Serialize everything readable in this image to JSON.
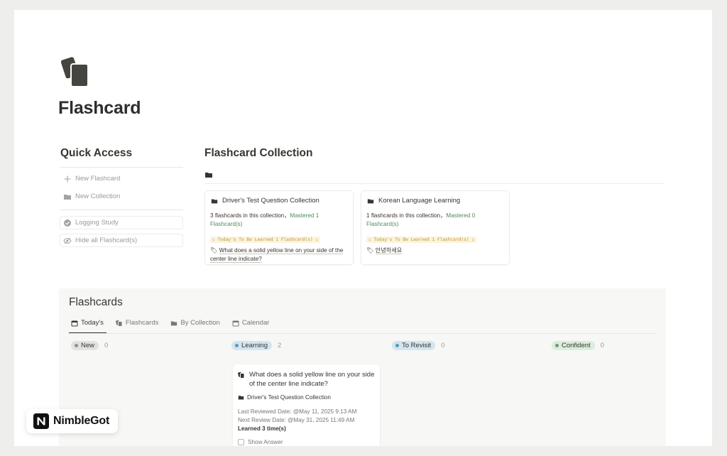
{
  "page": {
    "title": "Flashcard"
  },
  "quick_access": {
    "heading": "Quick Access",
    "items": [
      {
        "label": "New Flashcard",
        "icon": "plus-icon"
      },
      {
        "label": "New Collection",
        "icon": "folder-icon"
      },
      {
        "label": "Logging Study",
        "icon": "check-circle-icon"
      },
      {
        "label": "Hide all Flashcard(s)",
        "icon": "eye-off-icon"
      }
    ]
  },
  "collection": {
    "heading": "Flashcard Collection",
    "cards": [
      {
        "title": "Driver's Test Question Collection",
        "stat_prefix": "3 flashcards in this collection，",
        "stat_mastered": "Mastered 1 Flashcard(s)",
        "today_tag": "↓ Today's To Be Learned 1 Flashcard(s) ↓",
        "question": "What does a solid yellow line on your side of the center line indicate?"
      },
      {
        "title": "Korean Language Learning",
        "stat_prefix": "1 flashcards in this collection，",
        "stat_mastered": "Mastered 0 Flashcard(s)",
        "today_tag": "↓ Today's To Be Learned 1 Flashcard(s) ↓",
        "question": "안녕하세요"
      }
    ]
  },
  "board": {
    "title": "Flashcards",
    "tabs": [
      {
        "label": "Today's",
        "icon": "calendar-icon",
        "active": true
      },
      {
        "label": "Flashcards",
        "icon": "cards-icon",
        "active": false
      },
      {
        "label": "By Collection",
        "icon": "folder-icon",
        "active": false
      },
      {
        "label": "Calendar",
        "icon": "calendar-icon",
        "active": false
      }
    ],
    "columns": [
      {
        "label": "New",
        "count": "0",
        "bg": "#e3e2e0",
        "dot": "#91918e"
      },
      {
        "label": "Learning",
        "count": "2",
        "bg": "#d3e5ef",
        "dot": "#5b97bd"
      },
      {
        "label": "To Revisit",
        "count": "0",
        "bg": "#d3e5ef",
        "dot": "#5b97bd"
      },
      {
        "label": "Confident",
        "count": "0",
        "bg": "#dbeddb",
        "dot": "#6c9b7d"
      }
    ],
    "card": {
      "question": "What does a solid yellow line on your side of the center line indicate?",
      "collection": "Driver's Test Question Collection",
      "last_reviewed_label": "Last Reviewed Date: ",
      "last_reviewed": "@May 11, 2025 9:13 AM",
      "next_review_label": "Next Review Date: ",
      "next_review": "@May 31, 2025 11:49 AM",
      "learned": "Learned 3 time(s)",
      "show_answer": "Show Answer"
    }
  },
  "badge": {
    "text": "NimbleGot"
  }
}
